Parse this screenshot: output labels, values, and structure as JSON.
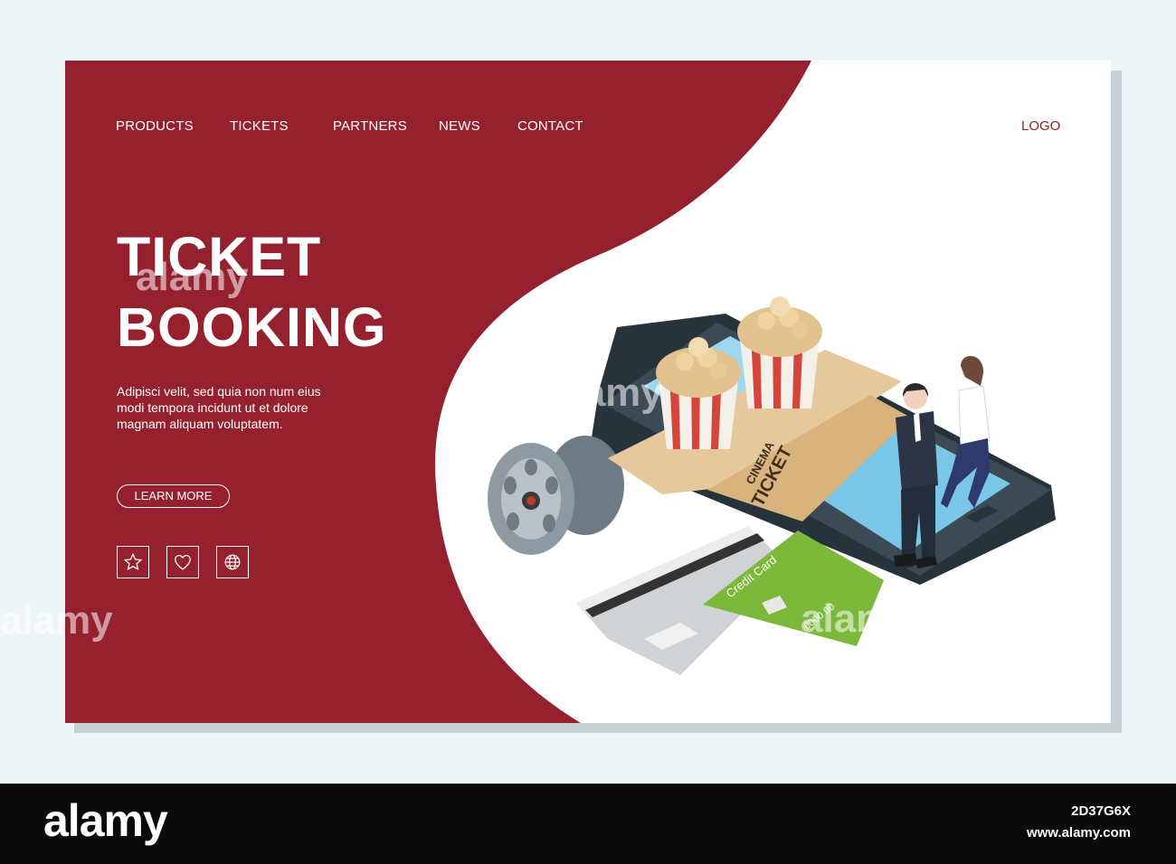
{
  "colors": {
    "primary": "#95212f",
    "background": "#eef5f6",
    "panel": "#ffffff"
  },
  "nav": {
    "items": [
      {
        "label": "PRODUCTS"
      },
      {
        "label": "TICKETS"
      },
      {
        "label": "PARTNERS"
      },
      {
        "label": "NEWS"
      },
      {
        "label": "CONTACT"
      }
    ],
    "logo": "LOGO"
  },
  "hero": {
    "title_line1": "TICKET",
    "title_line2": "BOOKING",
    "description": "Adipisci velit, sed quia non num eius modi tempora incidunt ut et dolore magnam aliquam voluptatem.",
    "cta_label": "LEARN MORE",
    "icons": [
      "star-icon",
      "heart-icon",
      "globe-icon"
    ]
  },
  "illustration": {
    "ticket_text_1": "CINEMA",
    "ticket_text_2": "TICKET",
    "card_text": "Credit Card",
    "card_number": "0000 00"
  },
  "stock": {
    "brand": "alamy",
    "image_id": "2D37G6X",
    "site": "www.alamy.com",
    "watermark": "alamy"
  }
}
